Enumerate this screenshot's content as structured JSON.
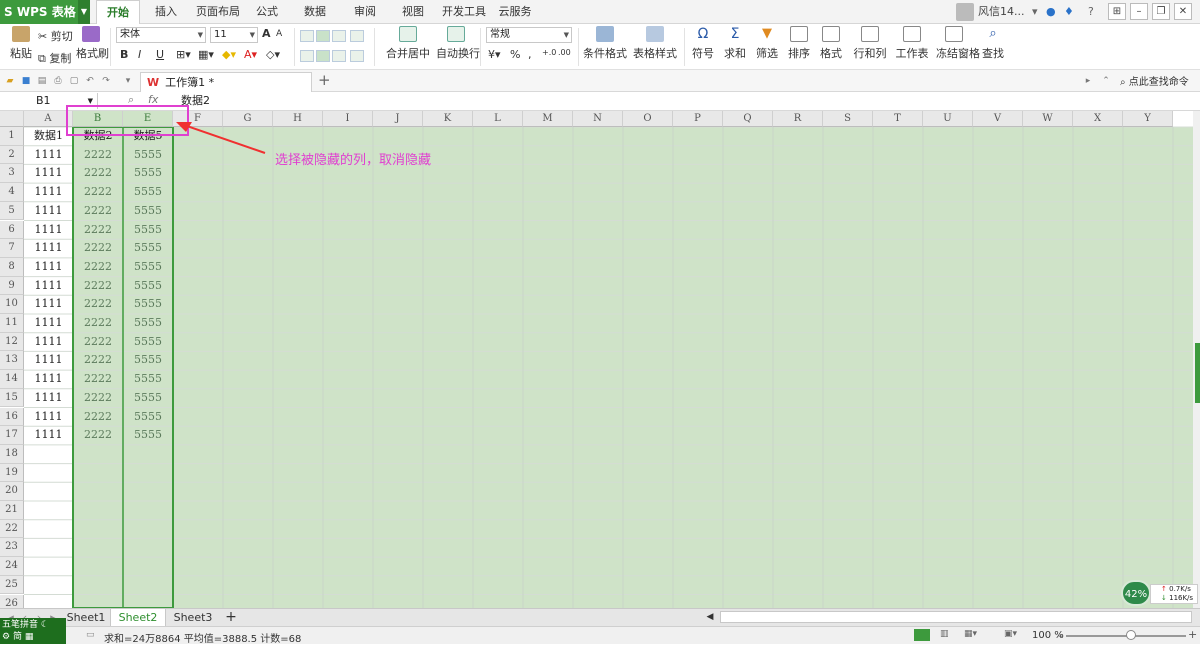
{
  "app": {
    "name": "WPS 表格",
    "logo": "S",
    "menu_tabs": [
      "开始",
      "插入",
      "页面布局",
      "公式",
      "数据",
      "审阅",
      "视图",
      "开发工具",
      "云服务"
    ],
    "active_tab": "开始",
    "user": "风信14..."
  },
  "ribbon": {
    "paste": "粘贴",
    "cut": "剪切",
    "copy": "复制",
    "format_painter": "格式刷",
    "font": "宋体",
    "font_size": "11",
    "bold": "B",
    "italic": "I",
    "underline": "U",
    "grow": "A",
    "shrink": "A",
    "merge_center": "合并居中",
    "wrap_text": "自动换行",
    "number_format": "常规",
    "percent": "%",
    "comma": ",",
    "inc_dec": "+.0",
    "dec_dec": ".00",
    "cond_format": "条件格式",
    "table_style": "表格样式",
    "symbol": "符号",
    "sum": "求和",
    "filter": "筛选",
    "sort": "排序",
    "format": "格式",
    "row_col": "行和列",
    "worksheet": "工作表",
    "freeze": "冻结窗格",
    "find": "查找"
  },
  "doc": {
    "tab": "工作簿1 *",
    "find_cmd": "点此查找命令"
  },
  "formula_bar": {
    "name_box": "B1",
    "fx": "fx",
    "value": "数据2"
  },
  "columns": [
    "A",
    "B",
    "E",
    "F",
    "G",
    "H",
    "I",
    "J",
    "K",
    "L",
    "M",
    "N",
    "O",
    "P",
    "Q",
    "R",
    "S",
    "T",
    "U",
    "V",
    "W",
    "X",
    "Y"
  ],
  "rows": [
    "1",
    "2",
    "3",
    "4",
    "5",
    "6",
    "7",
    "8",
    "9",
    "10",
    "11",
    "12",
    "13",
    "14",
    "15",
    "16",
    "17",
    "18",
    "19",
    "20",
    "21",
    "22",
    "23",
    "24",
    "25",
    "26"
  ],
  "cells": {
    "header": [
      "数据1",
      "数据2",
      "数据5"
    ],
    "data_values": [
      "1111",
      "2222",
      "5555"
    ]
  },
  "callout": "选择被隐藏的列，取消隐藏",
  "sheet_tabs": [
    "Sheet1",
    "Sheet2",
    "Sheet3"
  ],
  "active_sheet": "Sheet2",
  "status": {
    "summary": "求和=24万8864  平均值=3888.5  计数=68",
    "zoom": "100 %"
  },
  "ime": {
    "line1": "五笔拼音",
    "line2": "简"
  },
  "net": {
    "percent": "42%",
    "up": "0.7K/s",
    "down": "116K/s"
  },
  "colors": {
    "accent": "#3d9a3d",
    "selection": "#cfe3c8",
    "callout": "#e040d0"
  }
}
